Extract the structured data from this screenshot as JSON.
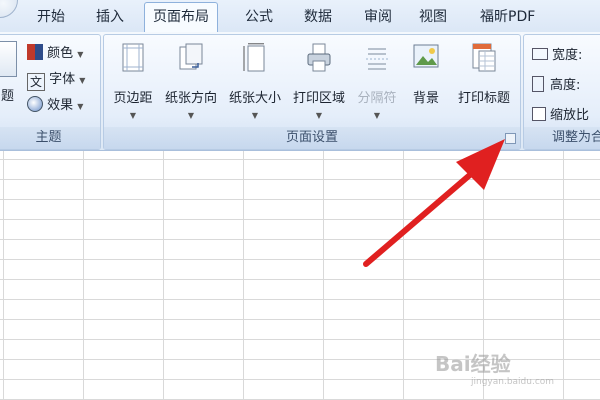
{
  "tabs": {
    "home": "开始",
    "insert": "插入",
    "page_layout": "页面布局",
    "formulas": "公式",
    "data": "数据",
    "review": "审阅",
    "view": "视图",
    "foxit_pdf": "福昕PDF"
  },
  "themes_group": {
    "themes_label_partial": "题",
    "colors": "颜色",
    "fonts": "字体",
    "effects": "效果",
    "group_label": "主题"
  },
  "page_setup_group": {
    "margins": "页边距",
    "orientation": "纸张方向",
    "size": "纸张大小",
    "print_area": "打印区域",
    "breaks": "分隔符",
    "background": "背景",
    "print_titles": "打印标题",
    "group_label": "页面设置"
  },
  "scale_group": {
    "width": "宽度:",
    "height": "高度:",
    "scale": "缩放比",
    "group_label": "调整为合"
  },
  "watermark": {
    "text": "Bai经验",
    "sub": "jingyan.baidu.com"
  },
  "colors": {
    "accent_arrow": "#e02020",
    "ribbon_border": "#a9bfdc"
  }
}
